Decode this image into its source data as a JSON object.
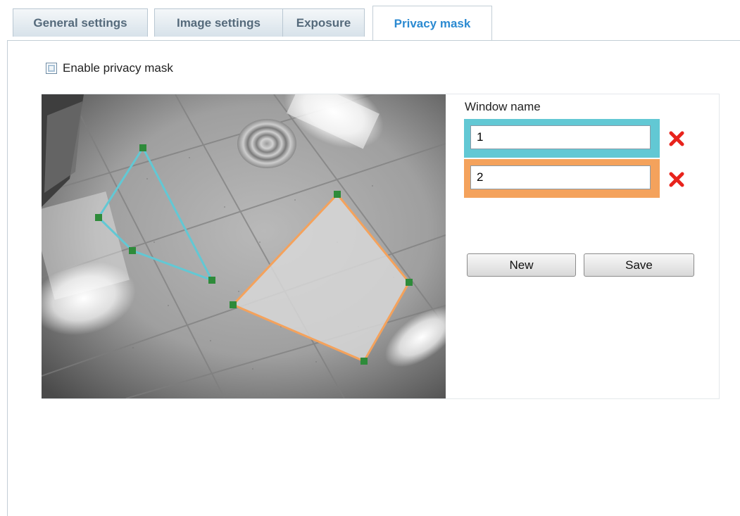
{
  "tabs": [
    {
      "label": "General settings"
    },
    {
      "label": "Image settings"
    },
    {
      "label": "Exposure"
    },
    {
      "label": "Privacy mask",
      "active": true
    }
  ],
  "enable_privacy_mask": {
    "label": "Enable privacy mask",
    "checked": false
  },
  "mask_panel": {
    "window_name_title": "Window name",
    "windows": [
      {
        "name": "1",
        "color": "#62c8d4"
      },
      {
        "name": "2",
        "color": "#f4a25c"
      }
    ],
    "buttons": {
      "new_label": "New",
      "save_label": "Save"
    }
  },
  "colors": {
    "active_tab_text": "#2b8ad1",
    "delete_icon": "#e8231c",
    "handle": "#2e8b3a"
  }
}
